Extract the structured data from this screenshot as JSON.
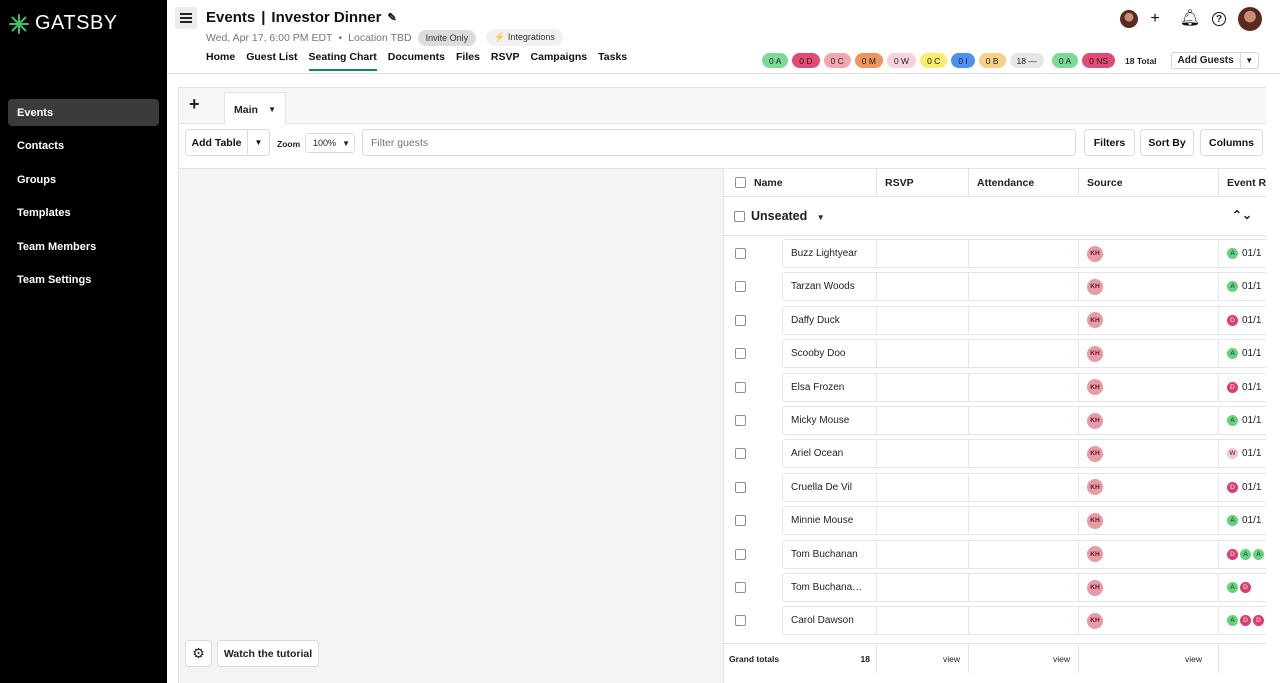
{
  "app": {
    "logo": "GATSBY"
  },
  "sidebar": {
    "items": [
      {
        "label": "Events",
        "active": true
      },
      {
        "label": "Contacts"
      },
      {
        "label": "Groups"
      },
      {
        "label": "Templates"
      },
      {
        "label": "Team Members"
      },
      {
        "label": "Team Settings"
      }
    ]
  },
  "header": {
    "section": "Events",
    "separator": "|",
    "event_name": "Investor Dinner",
    "datetime": "Wed, Apr 17, 6:00 PM EDT",
    "bullet": "•",
    "location": "Location TBD",
    "invite_pill": "Invite Only",
    "integrations_pill": "⚡ Integrations",
    "tabs": [
      "Home",
      "Guest List",
      "Seating Chart",
      "Documents",
      "Files",
      "RSVP",
      "Campaigns",
      "Tasks"
    ],
    "active_tab": "Seating Chart"
  },
  "stats": [
    {
      "label": "0 A",
      "color": "#7ed896"
    },
    {
      "label": "0 D",
      "color": "#e44a76"
    },
    {
      "label": "0 C",
      "color": "#f2a7ae"
    },
    {
      "label": "0 M",
      "color": "#f0945c"
    },
    {
      "label": "0 W",
      "color": "#f7d2dc"
    },
    {
      "label": "0 C",
      "color": "#f9ec6e"
    },
    {
      "label": "0 I",
      "color": "#4f8ff0"
    },
    {
      "label": "0 B",
      "color": "#f6cf88"
    },
    {
      "label": "18 —",
      "color": "#e6e6e6"
    },
    {
      "label": "0 A",
      "color": "#7ed896"
    },
    {
      "label": "0 NS",
      "color": "#e44a76"
    }
  ],
  "stats_total": "18 Total",
  "add_guests": "Add Guests",
  "seating": {
    "add_tab": "+",
    "tab_main": "Main",
    "add_table": "Add Table",
    "zoom_label": "Zoom",
    "zoom_value": "100%",
    "filter_placeholder": "Filter guests",
    "filters": "Filters",
    "sort_by": "Sort By",
    "columns": "Columns",
    "watch_tutorial": "Watch the tutorial"
  },
  "grid": {
    "headers": {
      "name": "Name",
      "rsvp": "RSVP",
      "attendance": "Attendance",
      "source": "Source",
      "event_rsvp": "Event RS"
    },
    "group": "Unseated",
    "rows": [
      {
        "name": "Buzz Lightyear",
        "source": "KH",
        "badges": [
          "A"
        ],
        "date": "01/1"
      },
      {
        "name": "Tarzan Woods",
        "source": "KH",
        "badges": [
          "A"
        ],
        "date": "01/1"
      },
      {
        "name": "Daffy Duck",
        "source": "KH",
        "badges": [
          "D"
        ],
        "date": "01/1"
      },
      {
        "name": "Scooby Doo",
        "source": "KH",
        "badges": [
          "A"
        ],
        "date": "01/1"
      },
      {
        "name": "Elsa Frozen",
        "source": "KH",
        "badges": [
          "D"
        ],
        "date": "01/1"
      },
      {
        "name": "Micky Mouse",
        "source": "KH",
        "badges": [
          "A"
        ],
        "date": "01/1"
      },
      {
        "name": "Ariel Ocean",
        "source": "KH",
        "badges": [
          "W"
        ],
        "date": "01/1"
      },
      {
        "name": "Cruella De Vil",
        "source": "KH",
        "badges": [
          "D"
        ],
        "date": "01/1"
      },
      {
        "name": "Minnie Mouse",
        "source": "KH",
        "badges": [
          "A"
        ],
        "date": "01/1"
      },
      {
        "name": "Tom Buchanan",
        "source": "KH",
        "badges": [
          "D",
          "A",
          "A"
        ],
        "date": ""
      },
      {
        "name": "Tom Buchana…",
        "source": "KH",
        "badges": [
          "A",
          "D"
        ],
        "date": ""
      },
      {
        "name": "Carol Dawson",
        "source": "KH",
        "badges": [
          "A",
          "D",
          "D"
        ],
        "date": ""
      }
    ],
    "totals": {
      "label": "Grand totals",
      "count": "18",
      "rsvp_link": "view",
      "attendance_link": "view",
      "source_link": "view"
    }
  }
}
